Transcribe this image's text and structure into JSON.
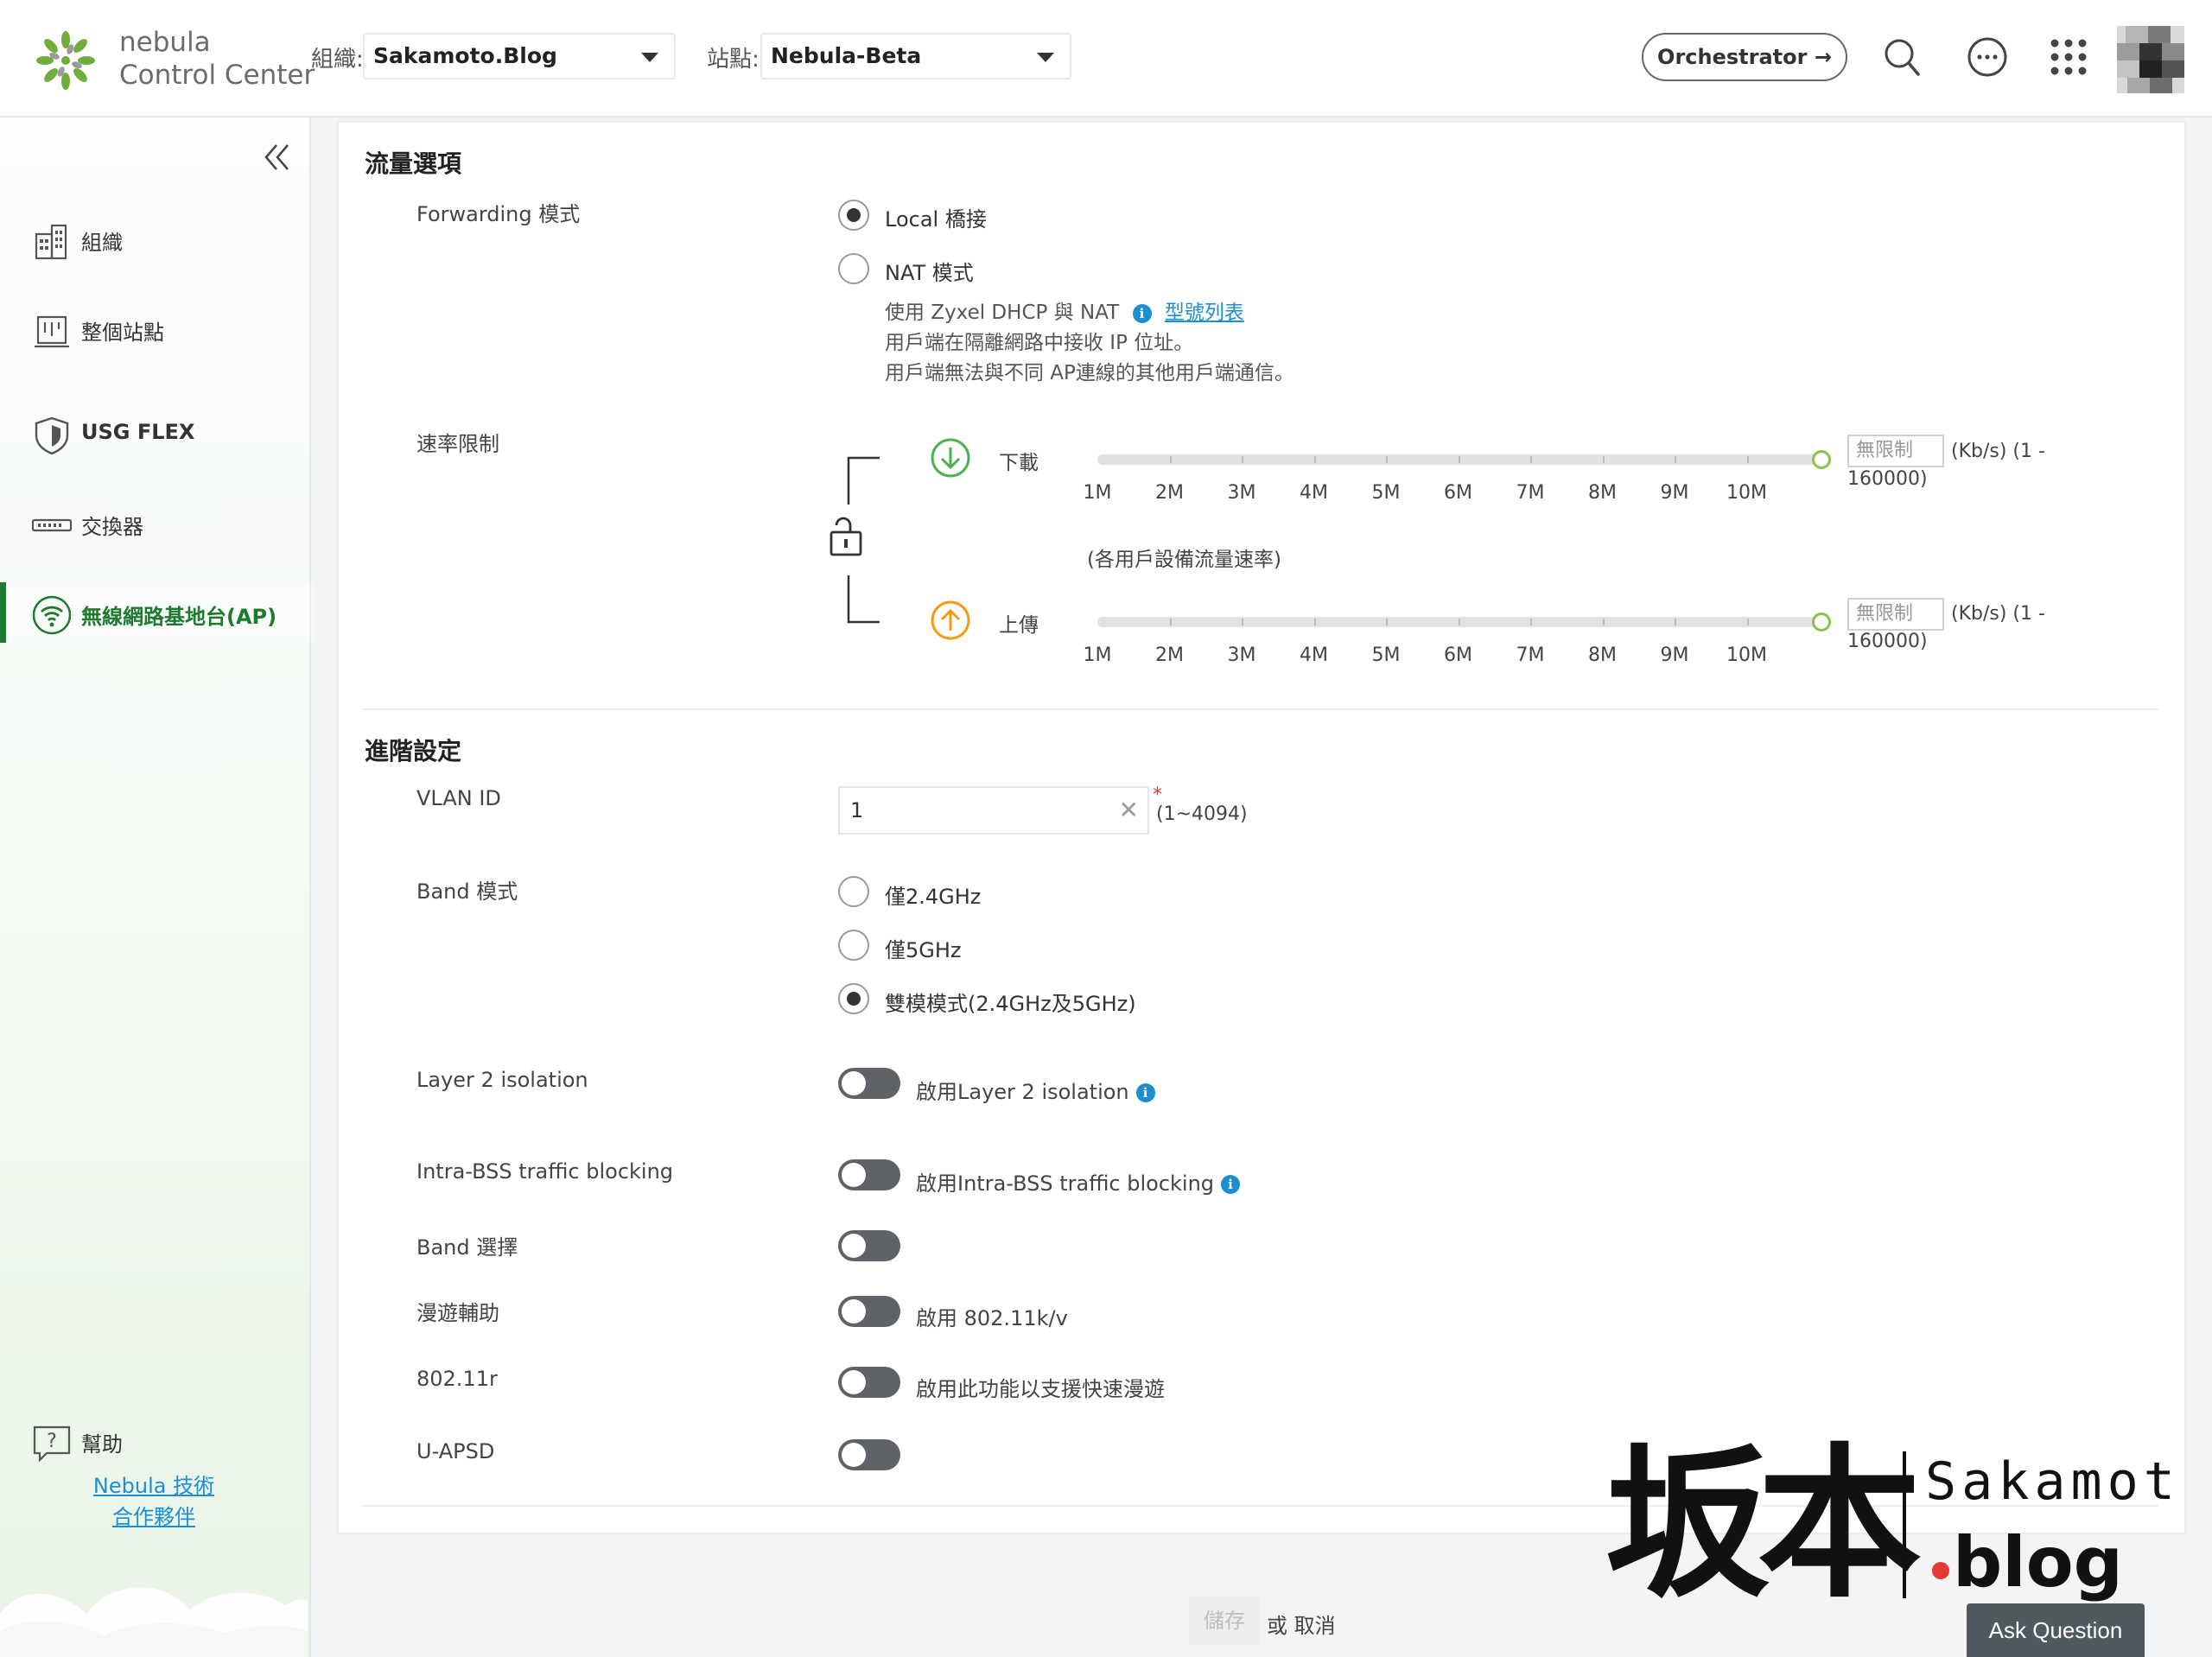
{
  "header": {
    "logo_line1": "nebula",
    "logo_line2": "Control Center",
    "org_label": "組織:",
    "org_value": "Sakamoto.Blog",
    "site_label": "站點:",
    "site_value": "Nebula-Beta",
    "orchestrator_label": "Orchestrator →",
    "icons": [
      "search-icon",
      "chat-icon",
      "apps-grid-icon",
      "avatar"
    ]
  },
  "sidebar": {
    "items": [
      {
        "label": "組織",
        "icon": "building-icon"
      },
      {
        "label": "整個站點",
        "icon": "site-icon"
      },
      {
        "label": "USG FLEX",
        "icon": "shield-icon"
      },
      {
        "label": "交換器",
        "icon": "switch-icon"
      },
      {
        "label": "無線網路基地台(AP)",
        "icon": "wifi-icon"
      }
    ],
    "active_index": 4,
    "help_label": "幫助",
    "partner_line1": "Nebula 技術",
    "partner_line2": "合作夥伴"
  },
  "traffic": {
    "title": "流量選項",
    "forwarding_label": "Forwarding 模式",
    "local_label": "Local 橋接",
    "nat_label": "NAT 模式",
    "nat_note_prefix": "使用 Zyxel DHCP 與 NAT",
    "nat_note_link": "型號列表",
    "nat_note_2": "用戶端在隔離網路中接收 IP 位址。",
    "nat_note_3": "用戶端無法與不同 AP連線的其他用戶端通信。",
    "selected": "local",
    "rate_label": "速率限制",
    "download_label": "下載",
    "upload_label": "上傳",
    "per_client_note": "(各用戶設備流量速率)",
    "ticks": [
      "1M",
      "2M",
      "3M",
      "4M",
      "5M",
      "6M",
      "7M",
      "8M",
      "9M",
      "10M"
    ],
    "download_placeholder": "無限制",
    "upload_placeholder": "無限制",
    "unit_text": "(Kb/s)  (1 -",
    "unit_text_2": "160000)",
    "download_level": 1.0,
    "upload_level": 1.0
  },
  "advanced": {
    "title": "進階設定",
    "vlan_label": "VLAN ID",
    "vlan_value": "1",
    "vlan_required": "*",
    "vlan_range": "(1~4094)",
    "band_label": "Band 模式",
    "band_options": [
      "僅2.4GHz",
      "僅5GHz",
      "雙模模式(2.4GHz及5GHz)"
    ],
    "band_selected": 2,
    "l2_label": "Layer 2 isolation",
    "l2_toggle_label": "啟用Layer 2 isolation",
    "intra_label": "Intra-BSS traffic blocking",
    "intra_toggle_label": "啟用Intra-BSS traffic blocking",
    "band_steer_label": "Band 選擇",
    "roaming_label": "漫遊輔助",
    "roaming_toggle_label": "啟用 802.11k/v",
    "r_label": "802.11r",
    "r_toggle_label": "啟用此功能以支援快速漫遊",
    "uapsd_label": "U-APSD"
  },
  "footer": {
    "save_label": "儲存",
    "cancel_label": "或 取消",
    "ask_label": "Ask Question"
  },
  "watermark": {
    "kanji": "坂本",
    "latin": "Sakamoto",
    "blog": ".blog"
  },
  "colors": {
    "accent_green": "#1d7a2e",
    "link_blue": "#1c8fd2",
    "download_green": "#4caf50",
    "upload_orange": "#f39c12",
    "toggle_off": "#5f6368"
  }
}
